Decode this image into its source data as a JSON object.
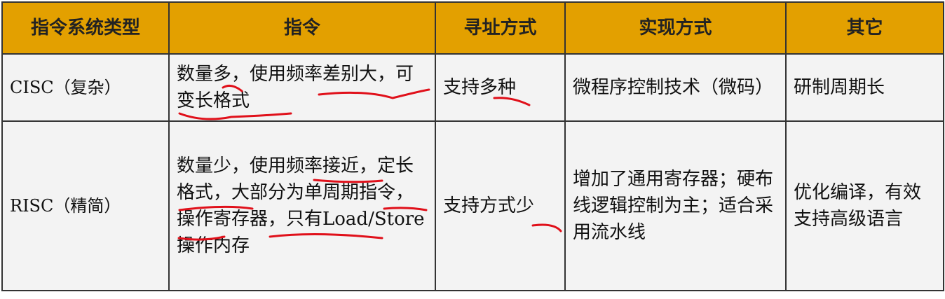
{
  "headers": [
    "指令系统类型",
    "指令",
    "寻址方式",
    "实现方式",
    "其它"
  ],
  "rows": [
    {
      "type": "CISC（复杂）",
      "instruction": "数量多，使用频率差别大，可变长格式",
      "addressing": "支持多种",
      "implementation": "微程序控制技术（微码）",
      "other": "研制周期长"
    },
    {
      "type": "RISC（精简）",
      "instruction": "数量少，使用频率接近，定长格式，大部分为单周期指令，操作寄存器，只有Load/Store操作内存",
      "addressing": "支持方式少",
      "implementation": "增加了通用寄存器；硬布线逻辑控制为主；适合采用流水线",
      "other": "优化编译，有效支持高级语言"
    }
  ],
  "colors": {
    "header": "#e3a000",
    "cell": "#f3f3f3",
    "annotation": "#e0101a"
  }
}
